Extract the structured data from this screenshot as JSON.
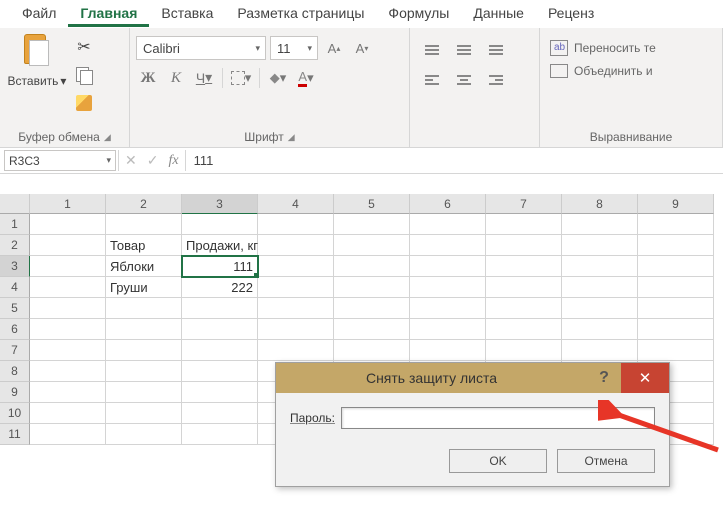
{
  "tabs": {
    "file": "Файл",
    "home": "Главная",
    "insert": "Вставка",
    "layout": "Разметка страницы",
    "formulas": "Формулы",
    "data": "Данные",
    "review": "Реценз"
  },
  "ribbon": {
    "clipboard": {
      "paste": "Вставить",
      "label": "Буфер обмена"
    },
    "font": {
      "name": "Calibri",
      "size": "11",
      "bold": "Ж",
      "italic": "К",
      "underline": "Ч",
      "label": "Шрифт"
    },
    "align": {
      "label": "Выравнивание",
      "wrap": "Переносить те",
      "merge": "Объединить и"
    }
  },
  "formula_bar": {
    "name_box": "R3C3",
    "fx": "fx",
    "value": "111"
  },
  "columns": [
    "1",
    "2",
    "3",
    "4",
    "5",
    "6",
    "7",
    "8",
    "9"
  ],
  "rows": [
    "1",
    "2",
    "3",
    "4",
    "5",
    "6",
    "7",
    "8",
    "9",
    "10",
    "11"
  ],
  "sheet": {
    "r2c2": "Товар",
    "r2c3": "Продажи, кг",
    "r3c2": "Яблоки",
    "r3c3": "111",
    "r4c2": "Груши",
    "r4c3": "222"
  },
  "dialog": {
    "title": "Снять защиту листа",
    "password_label": "Пароль:",
    "ok": "OK",
    "cancel": "Отмена"
  },
  "chart_data": {
    "type": "table",
    "headers": [
      "Товар",
      "Продажи, кг"
    ],
    "rows": [
      [
        "Яблоки",
        111
      ],
      [
        "Груши",
        222
      ]
    ]
  }
}
